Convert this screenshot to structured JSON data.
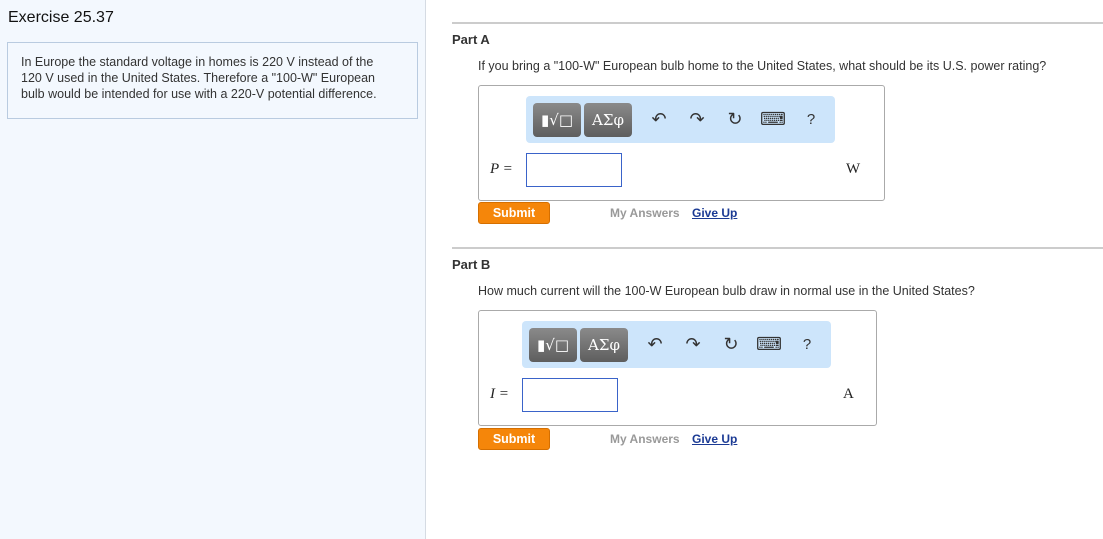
{
  "exercise": {
    "title": "Exercise 25.37",
    "problem": [
      "In Europe the standard voltage in homes is 220 V instead of the",
      "120 V used in the United States. Therefore a \"100-W\" European",
      "bulb would be intended for use with a 220-V potential difference."
    ]
  },
  "toolbar": {
    "templates": "▮√□",
    "symbols": "ΑΣφ",
    "undo": "↶",
    "redo": "↷",
    "reset": "↻",
    "keyboard": "⌨",
    "help": "?"
  },
  "parts": [
    {
      "title": "Part A",
      "question": "If you bring a \"100-W\" European bulb home to the United States, what should be its U.S. power rating?",
      "label": "P =",
      "value": "",
      "unit": "W",
      "submit": "Submit",
      "my_answers": "My Answers",
      "give_up": "Give Up"
    },
    {
      "title": "Part B",
      "question": "How much current will the 100-W European bulb draw in normal use in the United States?",
      "label": "I =",
      "value": "",
      "unit": "A",
      "submit": "Submit",
      "my_answers": "My Answers",
      "give_up": "Give Up"
    }
  ]
}
